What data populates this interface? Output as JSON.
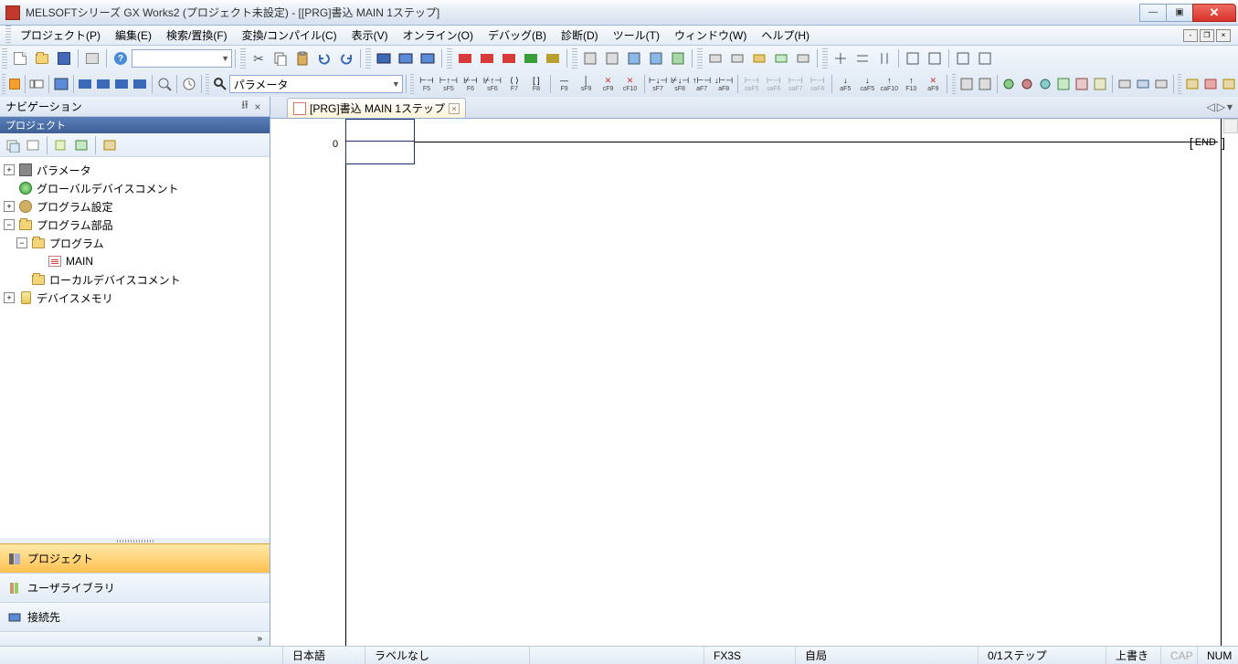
{
  "title": "MELSOFTシリーズ GX Works2 (プロジェクト未設定) - [[PRG]書込 MAIN 1ステップ]",
  "menu": {
    "project": "プロジェクト(P)",
    "edit": "編集(E)",
    "search": "検索/置換(F)",
    "convert": "変換/コンパイル(C)",
    "view": "表示(V)",
    "online": "オンライン(O)",
    "debug": "デバッグ(B)",
    "diag": "診断(D)",
    "tool": "ツール(T)",
    "window": "ウィンドウ(W)",
    "help": "ヘルプ(H)"
  },
  "toolbar": {
    "combo1": "",
    "combo2": "パラメータ",
    "help_q": "?"
  },
  "fkeys": {
    "f5": "F5",
    "sf5": "sF5",
    "f6": "F6",
    "sf6": "sF6",
    "f7": "F7",
    "f8": "F8",
    "f9": "F9",
    "sf9": "sF9",
    "cf9": "cF9",
    "cf10": "cF10",
    "sf7": "sF7",
    "sf8": "sF8",
    "af7": "aF7",
    "af8": "aF8",
    "saf5": "saF5",
    "saf6": "saF6",
    "saf7": "saF7",
    "saf8": "saF8",
    "af5": "aF5",
    "caf5": "caF5",
    "caf10": "caF10",
    "f10": "F10",
    "sf9b": "aF9"
  },
  "nav": {
    "header": "ナビゲーション",
    "section": "プロジェクト",
    "tree": {
      "param": "パラメータ",
      "gcomment": "グローバルデバイスコメント",
      "psetting": "プログラム設定",
      "pparts": "プログラム部品",
      "program": "プログラム",
      "main": "MAIN",
      "lcomment": "ローカルデバイスコメント",
      "devmem": "デバイスメモリ"
    },
    "btns": {
      "project": "プロジェクト",
      "userlib": "ユーザライブラリ",
      "connect": "接続先"
    }
  },
  "tab": {
    "label": "[PRG]書込 MAIN 1ステップ"
  },
  "ladder": {
    "row": "0",
    "end": "END"
  },
  "status": {
    "lang": "日本語",
    "label": "ラベルなし",
    "cpu": "FX3S",
    "station": "自局",
    "steps": "0/1ステップ",
    "ovr": "上書き",
    "cap": "CAP",
    "num": "NUM"
  }
}
